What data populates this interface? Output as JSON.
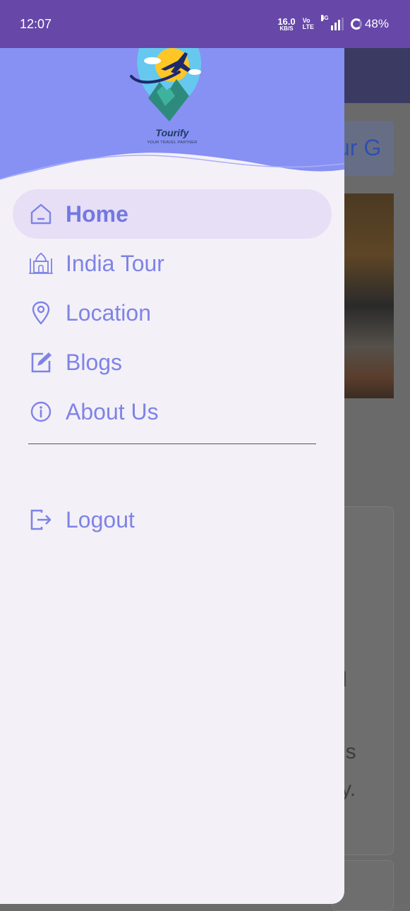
{
  "status_bar": {
    "time": "12:07",
    "net_speed_value": "16.0",
    "net_speed_unit": "KB/S",
    "volte_top": "Vo",
    "volte_bottom": "LTE",
    "network_type": "4G",
    "battery": "48%"
  },
  "background": {
    "title_fragment": "ur G",
    "card_fragments": [
      "l",
      "ns",
      "y."
    ]
  },
  "header": {
    "brand": "Tourify",
    "tagline": "YOUR TRAVEL PARTNER"
  },
  "drawer": {
    "items": [
      {
        "label": "Home",
        "icon": "home-icon",
        "active": true
      },
      {
        "label": "India Tour",
        "icon": "taj-mahal-icon",
        "active": false
      },
      {
        "label": "Location",
        "icon": "location-pin-icon",
        "active": false
      },
      {
        "label": "Blogs",
        "icon": "edit-note-icon",
        "active": false
      },
      {
        "label": "About Us",
        "icon": "info-icon",
        "active": false
      }
    ],
    "logout": {
      "label": "Logout",
      "icon": "logout-icon"
    }
  },
  "colors": {
    "status_bar": "#6747a8",
    "header": "#8790f3",
    "drawer_bg": "#f4f0f8",
    "active_pill": "#e6dff6",
    "accent": "#7d84e6"
  }
}
